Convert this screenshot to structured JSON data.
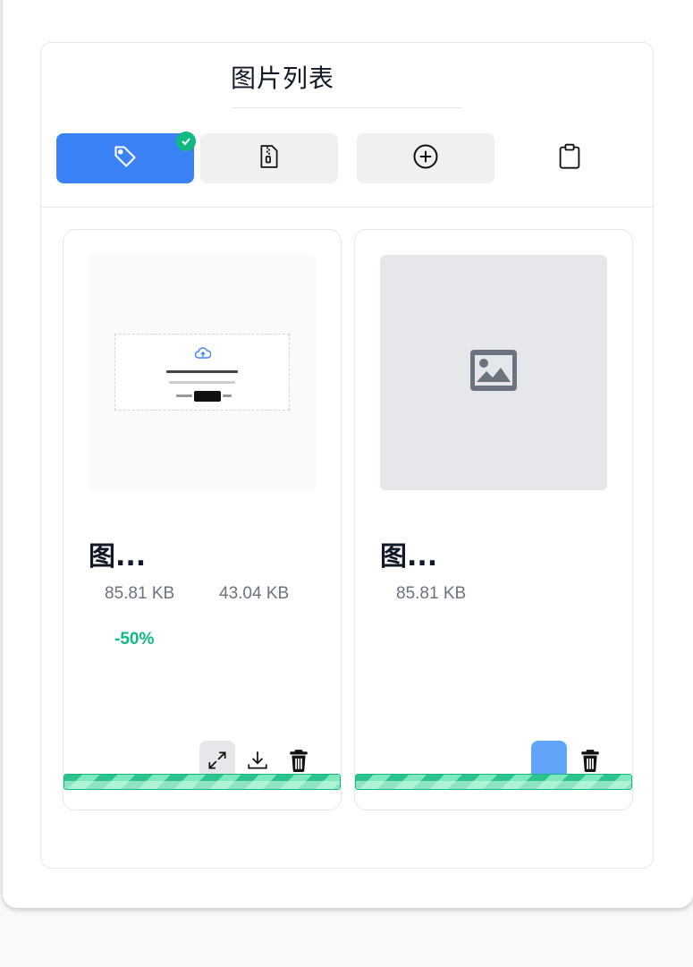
{
  "panel": {
    "title": "图片列表"
  },
  "toolbar": {
    "buttons": [
      {
        "icon": "tag-icon",
        "state": "active",
        "selected": true
      },
      {
        "icon": "zip-file-icon",
        "state": "default"
      },
      {
        "icon": "add-circle-icon",
        "state": "default"
      },
      {
        "icon": "clipboard-icon",
        "state": "plain"
      }
    ]
  },
  "cards": [
    {
      "name": "图...",
      "original_size": "85.81 KB",
      "compressed_size": "43.04 KB",
      "reduction": "-50%",
      "progress": 1.0,
      "thumbnail": "upload-screenshot-preview",
      "actions": [
        "expand-icon",
        "download-icon",
        "trash-icon"
      ]
    },
    {
      "name": "图...",
      "original_size": "85.81 KB",
      "progress": 1.0,
      "thumbnail": "image-placeholder-icon",
      "actions": [
        "trash-icon"
      ]
    }
  ],
  "colors": {
    "accent": "#3b82f6",
    "success": "#10b981",
    "text": "#111827",
    "muted": "#6b7280"
  }
}
